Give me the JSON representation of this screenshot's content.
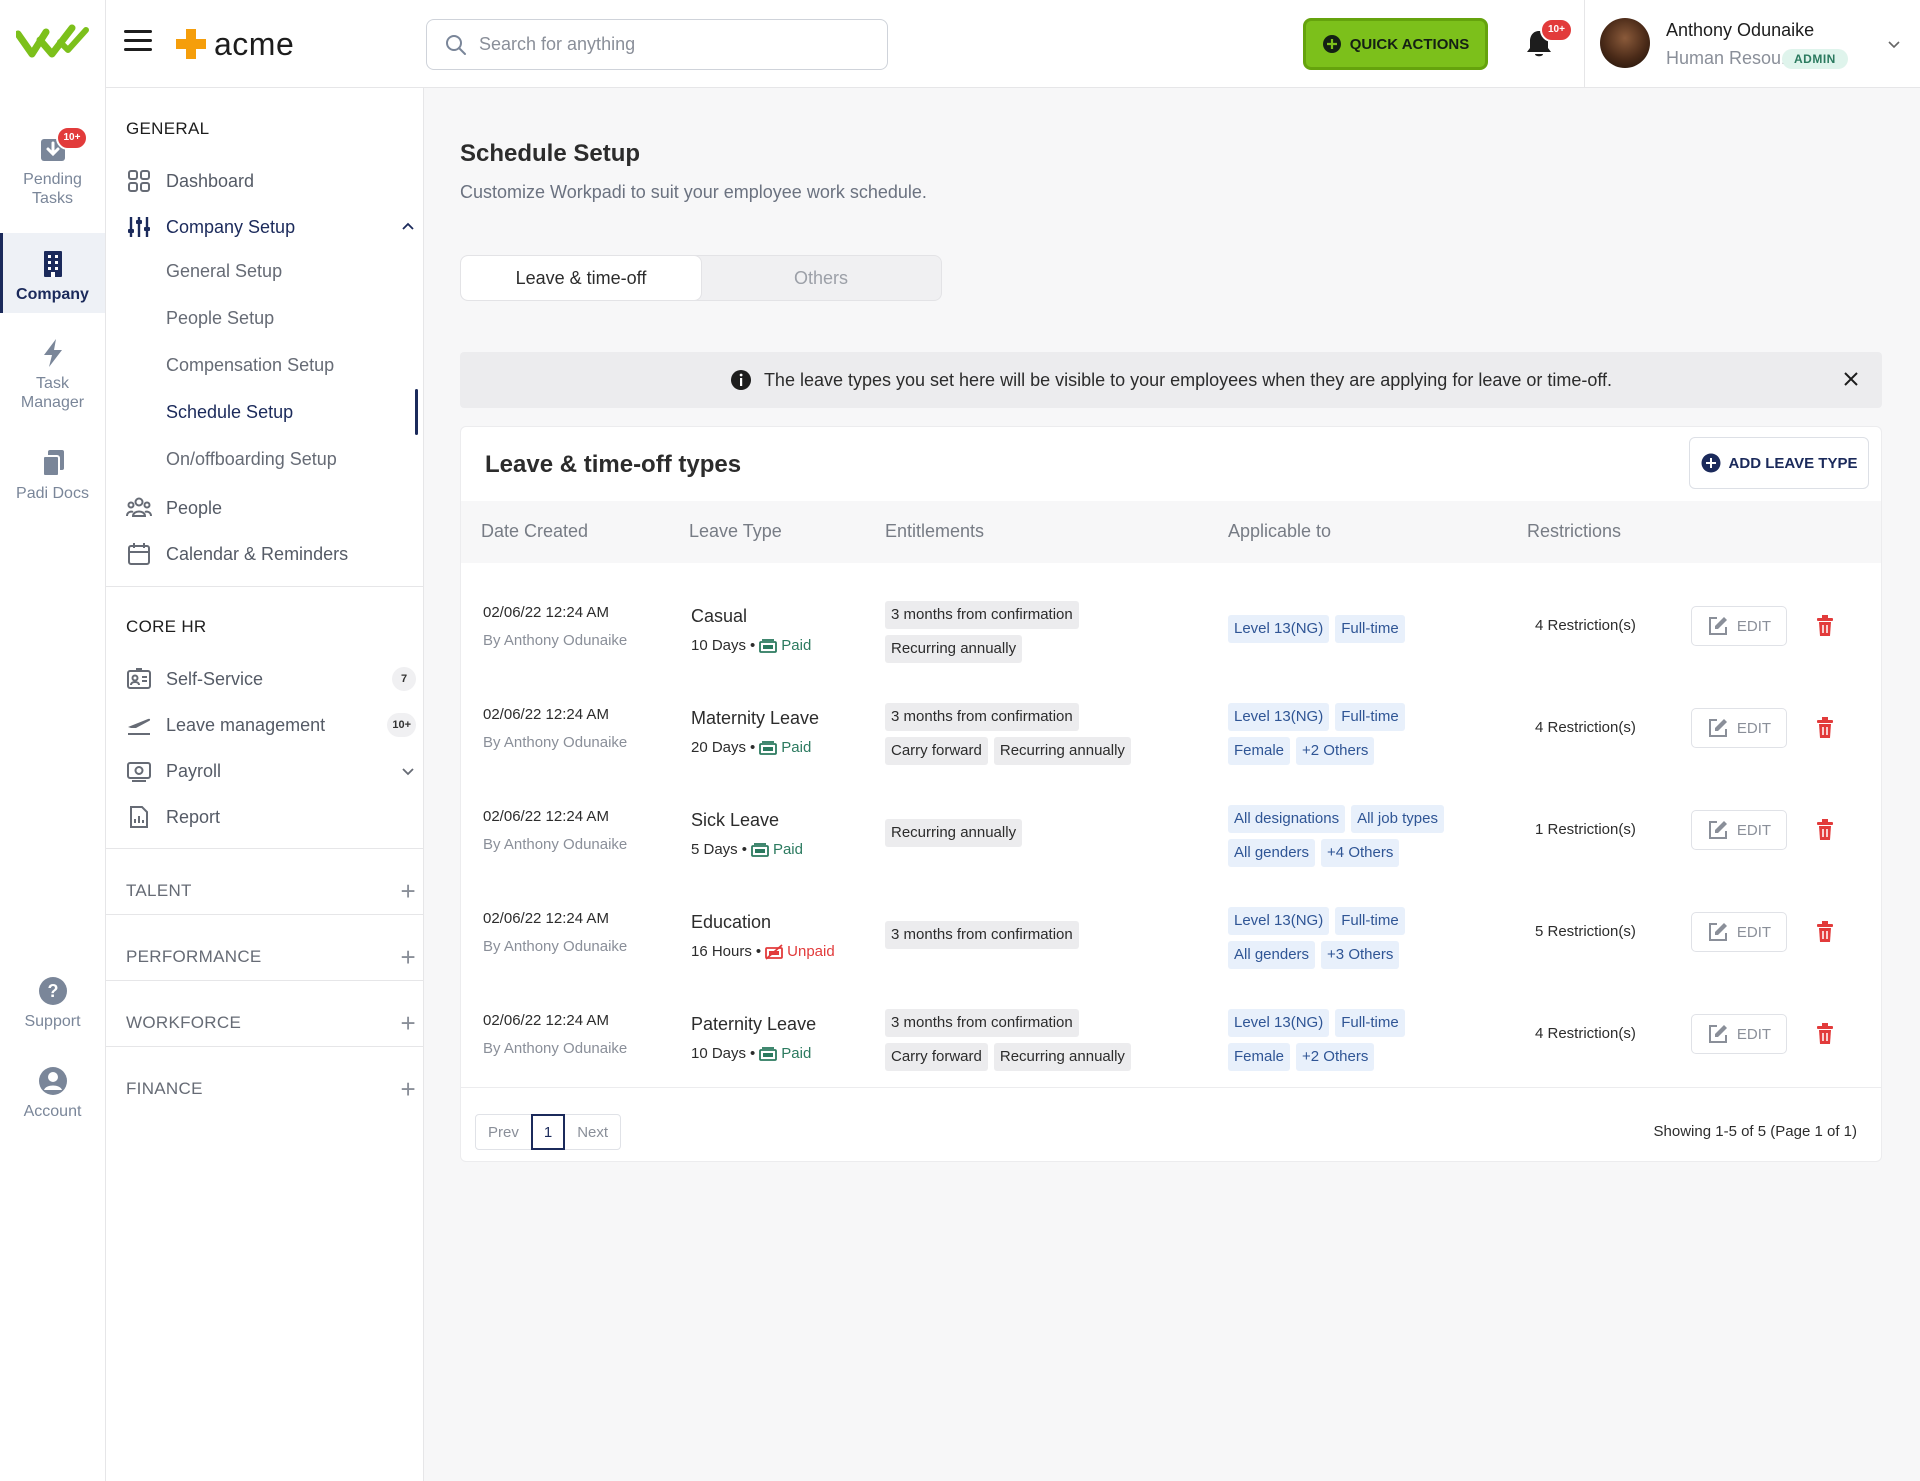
{
  "rail": {
    "items": [
      {
        "label_line1": "Pending",
        "label_line2": "Tasks",
        "badge": "10+"
      },
      {
        "label_line1": "Company",
        "label_line2": ""
      },
      {
        "label_line1": "Task",
        "label_line2": "Manager"
      },
      {
        "label_line1": "Padi Docs",
        "label_line2": ""
      },
      {
        "label_line1": "Support",
        "label_line2": ""
      },
      {
        "label_line1": "Account",
        "label_line2": ""
      }
    ]
  },
  "header": {
    "brand": "acme",
    "search_placeholder": "Search for anything",
    "quick_actions": "QUICK ACTIONS",
    "notification_badge": "10+",
    "user_name": "Anthony Odunaike",
    "user_role": "Human Resou...",
    "user_badge": "ADMIN"
  },
  "sidebar": {
    "general_title": "GENERAL",
    "dashboard": "Dashboard",
    "company_setup": "Company Setup",
    "sub": [
      "General Setup",
      "People Setup",
      "Compensation Setup",
      "Schedule Setup",
      "On/offboarding Setup"
    ],
    "people": "People",
    "calendar": "Calendar & Reminders",
    "core_title": "CORE HR",
    "self_service": "Self-Service",
    "self_service_count": "7",
    "leave_mgmt": "Leave management",
    "leave_count": "10+",
    "payroll": "Payroll",
    "report": "Report",
    "sections": [
      "TALENT",
      "PERFORMANCE",
      "WORKFORCE",
      "FINANCE"
    ]
  },
  "main": {
    "title": "Schedule Setup",
    "subtitle": "Customize Workpadi to suit your employee work schedule.",
    "tabs": [
      "Leave & time-off",
      "Others"
    ],
    "banner": "The leave types you set here will be visible to your employees when they are applying for leave or time-off.",
    "card_title": "Leave & time-off types",
    "add_button": "ADD LEAVE TYPE",
    "columns": [
      "Date Created",
      "Leave Type",
      "Entitlements",
      "Applicable to",
      "Restrictions"
    ],
    "rows": [
      {
        "date": "02/06/22 12:24 AM",
        "by": "By Anthony Odunaike",
        "name": "Casual",
        "duration": "10 Days",
        "pay": "Paid",
        "paid": true,
        "entitlements": [
          "3 months from confirmation",
          "Recurring annually"
        ],
        "applicable": [
          "Level 13(NG)",
          "Full-time"
        ],
        "restrictions": "4 Restriction(s)"
      },
      {
        "date": "02/06/22 12:24 AM",
        "by": "By Anthony Odunaike",
        "name": "Maternity Leave",
        "duration": "20 Days",
        "pay": "Paid",
        "paid": true,
        "entitlements": [
          "3 months from confirmation",
          "Carry forward",
          "Recurring annually"
        ],
        "applicable": [
          "Level 13(NG)",
          "Full-time",
          "Female",
          "+2 Others"
        ],
        "restrictions": "4 Restriction(s)"
      },
      {
        "date": "02/06/22 12:24 AM",
        "by": "By Anthony Odunaike",
        "name": "Sick Leave",
        "duration": "5 Days",
        "pay": "Paid",
        "paid": true,
        "entitlements": [
          "Recurring annually"
        ],
        "applicable": [
          "All designations",
          "All job types",
          "All genders",
          "+4 Others"
        ],
        "restrictions": "1 Restriction(s)"
      },
      {
        "date": "02/06/22 12:24 AM",
        "by": "By Anthony Odunaike",
        "name": "Education",
        "duration": "16 Hours",
        "pay": "Unpaid",
        "paid": false,
        "entitlements": [
          "3 months from confirmation"
        ],
        "applicable": [
          "Level 13(NG)",
          "Full-time",
          "All genders",
          "+3 Others"
        ],
        "restrictions": "5 Restriction(s)"
      },
      {
        "date": "02/06/22 12:24 AM",
        "by": "By Anthony Odunaike",
        "name": "Paternity Leave",
        "duration": "10 Days",
        "pay": "Paid",
        "paid": true,
        "entitlements": [
          "3 months from confirmation",
          "Carry forward",
          "Recurring annually"
        ],
        "applicable": [
          "Level 13(NG)",
          "Full-time",
          "Female",
          "+2 Others"
        ],
        "restrictions": "4 Restriction(s)"
      }
    ],
    "edit_label": "EDIT",
    "pager": {
      "prev": "Prev",
      "page": "1",
      "next": "Next",
      "showing": "Showing 1-5 of 5 (Page 1 of 1)"
    }
  },
  "colors": {
    "accent": "#1b2a5b",
    "brand_green": "#7cc01b",
    "brand_orange": "#f59e0b",
    "danger": "#e23b3b",
    "paid": "#2b7a5f"
  }
}
